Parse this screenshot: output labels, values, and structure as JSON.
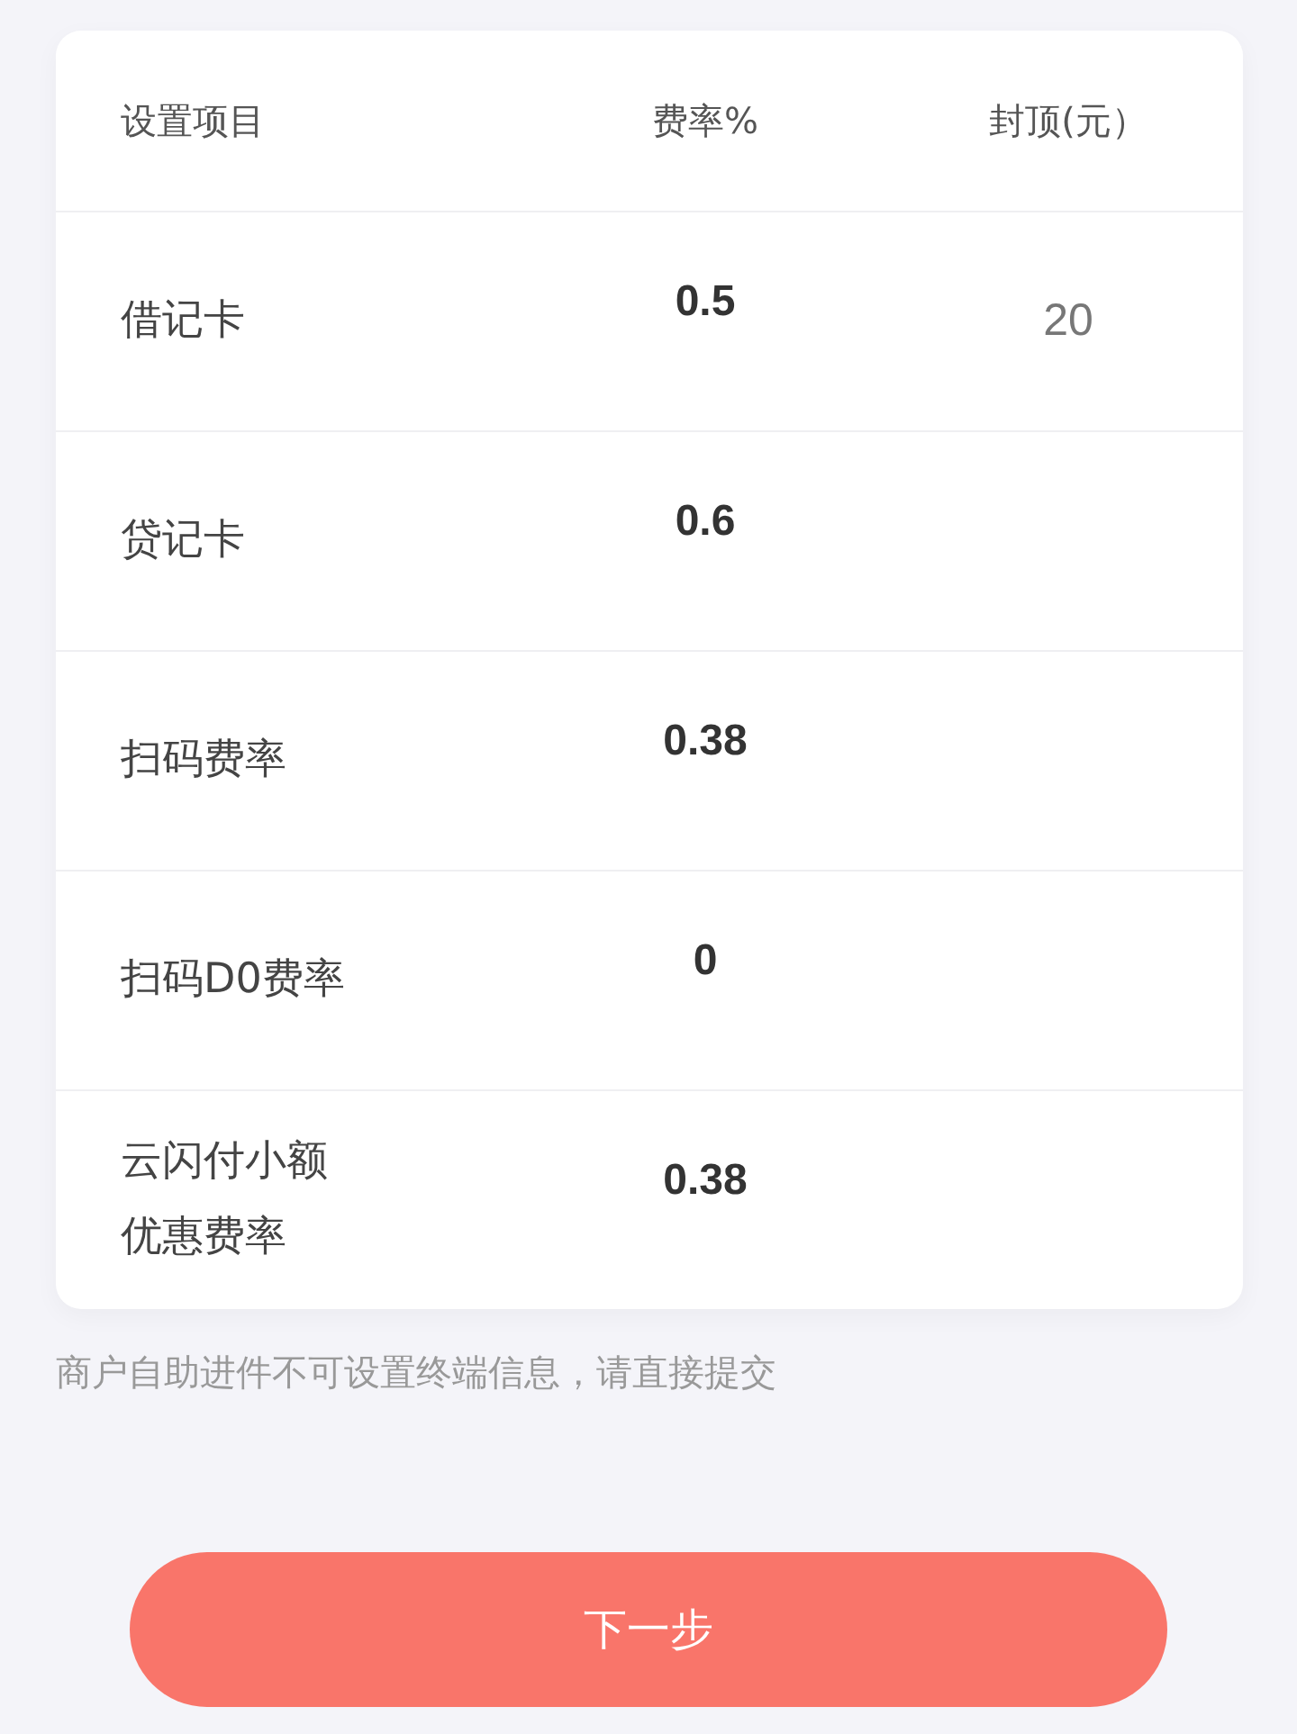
{
  "table": {
    "columns": [
      "设置项目",
      "费率%",
      "封顶(元）"
    ],
    "rows": [
      {
        "item": "借记卡",
        "rate": "0.5",
        "cap": "20"
      },
      {
        "item": "贷记卡",
        "rate": "0.6"
      },
      {
        "item": "扫码费率",
        "rate": "0.38"
      },
      {
        "item": "扫码D0费率",
        "rate": "0"
      },
      {
        "item": "云闪付小额优惠费率",
        "rate": "0.38"
      }
    ]
  },
  "note": "商户自助进件不可设置终端信息，请直接提交",
  "button": "下一步"
}
